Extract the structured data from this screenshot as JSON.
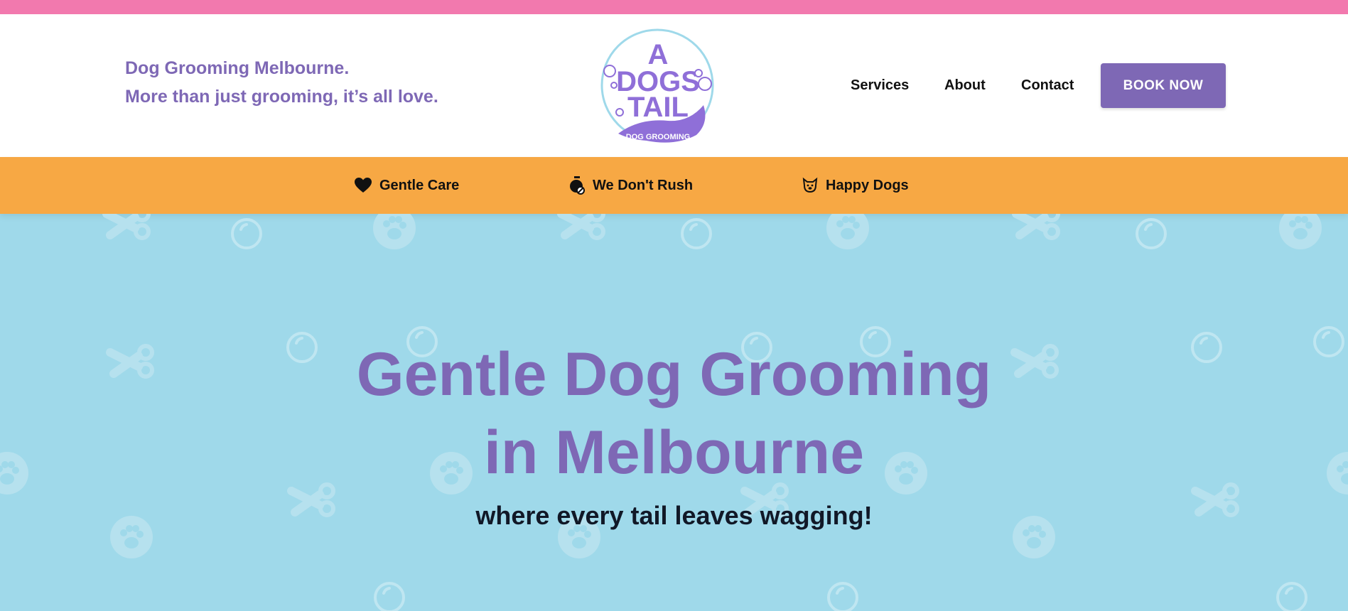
{
  "header": {
    "tagline_line1": "Dog Grooming Melbourne.",
    "tagline_line2": "More than just grooming, it’s all love.",
    "logo": {
      "letter_a": "A",
      "word_dogs": "DOGS",
      "word_tail": "TAIL",
      "ribbon": "DOG GROOMING"
    },
    "nav": [
      "Services",
      "About",
      "Contact"
    ],
    "book_label": "BOOK NOW"
  },
  "features": [
    {
      "label": "Gentle Care",
      "icon": "heart-icon"
    },
    {
      "label": "We Don't Rush",
      "icon": "stopwatch-icon"
    },
    {
      "label": "Happy Dogs",
      "icon": "dog-face-icon"
    }
  ],
  "hero": {
    "title_line1": "Gentle Dog Grooming",
    "title_line2": "in Melbourne",
    "subtitle": "where every tail leaves wagging!"
  },
  "colors": {
    "pink_strip": "#f279ae",
    "purple": "#7e68b5",
    "orange": "#f7a844",
    "hero_blue": "#9fd9ea"
  }
}
